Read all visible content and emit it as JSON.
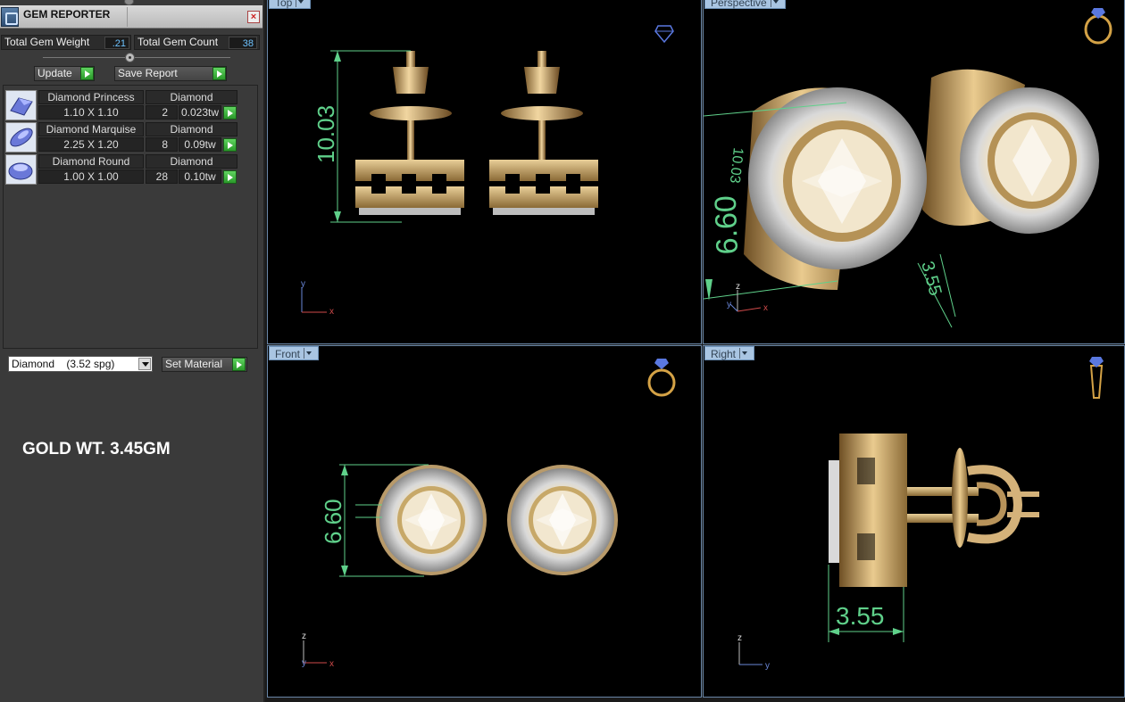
{
  "panel": {
    "title": "GEM REPORTER",
    "close_label": "×",
    "total_weight_label": "Total Gem Weight",
    "total_weight_value": ".21",
    "total_count_label": "Total Gem Count",
    "total_count_value": "38",
    "update_label": "Update",
    "save_report_label": "Save Report",
    "gems": [
      {
        "shape": "Diamond Princess",
        "material": "Diamond",
        "size": "1.10 X 1.10",
        "count": "2",
        "weight": "0.023tw"
      },
      {
        "shape": "Diamond Marquise",
        "material": "Diamond",
        "size": "2.25 X 1.20",
        "count": "8",
        "weight": "0.09tw"
      },
      {
        "shape": "Diamond Round",
        "material": "Diamond",
        "size": "1.00 X 1.00",
        "count": "28",
        "weight": "0.10tw"
      }
    ],
    "material_select_value": "Diamond    (3.52 spg)",
    "set_material_label": "Set Material",
    "gold_weight_text": "GOLD WT. 3.45GM"
  },
  "viewports": {
    "top": {
      "tab": "Top",
      "dimension": "10.03",
      "icon": "gem-icon"
    },
    "perspective": {
      "tab": "Perspective",
      "dimension_a": "6.60",
      "dimension_b": "10.03",
      "dimension_c": "3.55",
      "icon": "ring-icon"
    },
    "front": {
      "tab": "Front",
      "dimension": "6.60",
      "icon": "ring-icon"
    },
    "right": {
      "tab": "Right",
      "dimension": "3.55",
      "icon": "side-ring-icon"
    }
  },
  "axes": {
    "x": "x",
    "y": "y",
    "z": "z"
  },
  "colors": {
    "gold": "#d4b27a",
    "dimension": "#5fd08a",
    "viewport_tab": "#a9c5e2",
    "accent_green": "#3fb53f"
  }
}
